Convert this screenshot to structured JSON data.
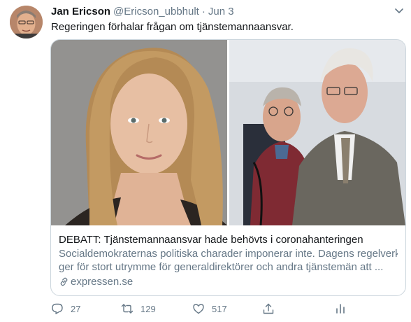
{
  "tweet": {
    "author_name": "Jan Ericson",
    "handle": "@Ericson_ubbhult",
    "separator": "·",
    "date": "Jun 3",
    "text": "Regeringen förhalar frågan om tjänstemannaansvar."
  },
  "card": {
    "title": "DEBATT: Tjänstemannaansvar hade behövts i coronahanteringen",
    "description_line1": "Socialdemokraternas politiska charader imponerar inte. Dagens regelverk",
    "description_line2": "ger för stort utrymme för generaldirektörer och andra tjänstemän att ...",
    "domain": "expressen.se"
  },
  "actions": {
    "replies": "27",
    "retweets": "129",
    "likes": "517"
  },
  "icons": {
    "reply": "reply-icon",
    "retweet": "retweet-icon",
    "like": "heart-icon",
    "share": "share-icon",
    "analytics": "analytics-icon",
    "more": "chevron-down-icon",
    "link": "link-icon"
  },
  "colors": {
    "text_primary": "#14171a",
    "text_secondary": "#657786",
    "border": "#ccd6dd"
  }
}
